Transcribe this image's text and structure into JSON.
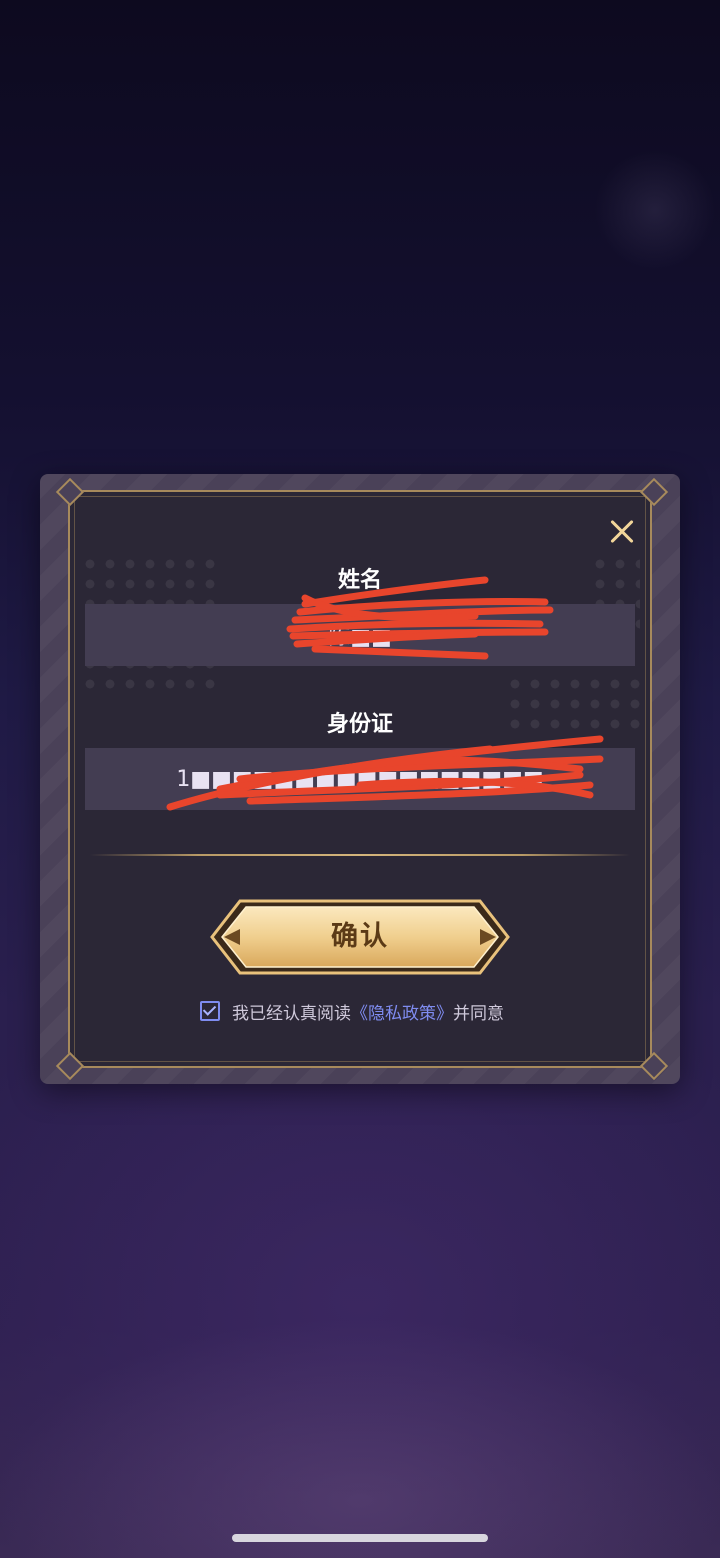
{
  "dialog": {
    "name_label": "姓名",
    "name_value": "陈■■",
    "id_label": "身份证",
    "id_value": "1■■■■■■■■■■■■■■■■■",
    "close_icon": "close-icon",
    "confirm_label": "确认",
    "agreement": {
      "checked": true,
      "prefix": "我已经认真阅读",
      "policy_link": "《隐私政策》",
      "suffix": "并同意"
    }
  },
  "colors": {
    "gold_accent": "#f2d69a",
    "frame_border": "#a78a5c",
    "link": "#7f8cf0",
    "redaction": "#e8452c"
  }
}
